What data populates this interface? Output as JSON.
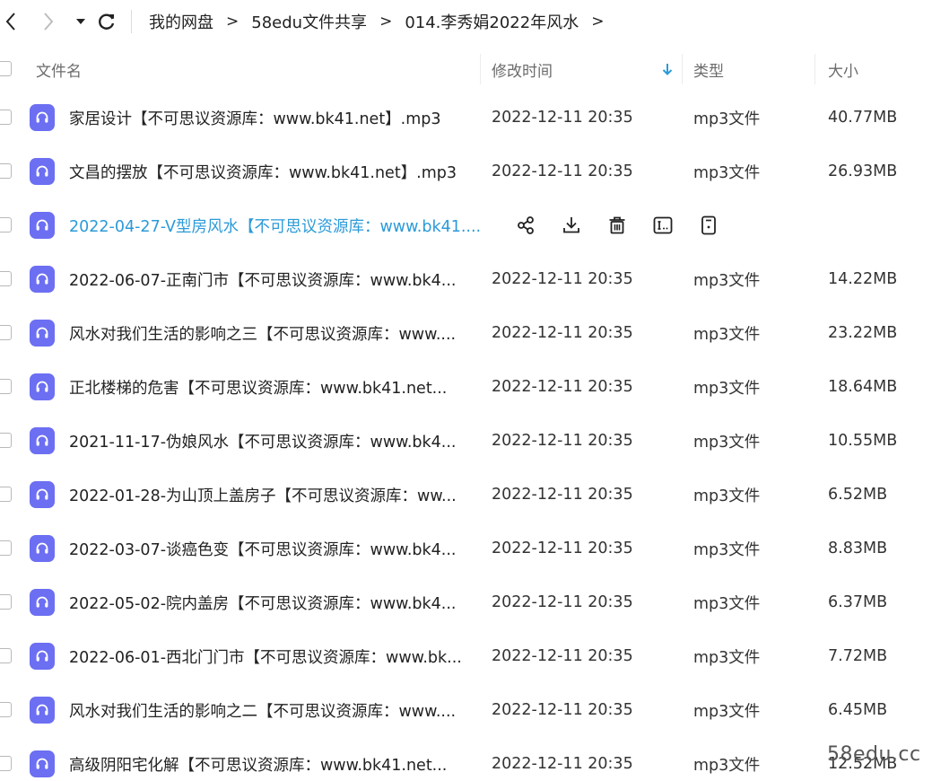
{
  "nav": {
    "back_icon": "chevron-left-icon",
    "forward_icon": "chevron-right-icon",
    "dropdown_icon": "caret-down-icon",
    "refresh_icon": "refresh-icon",
    "breadcrumbs": [
      "我的网盘",
      "58edu文件共享",
      "014.李秀娟2022年风水"
    ],
    "separator": ">"
  },
  "columns": {
    "name": "文件名",
    "modified": "修改时间",
    "type": "类型",
    "size": "大小",
    "sort_icon": "sort-down-arrow-icon"
  },
  "colors": {
    "accent": "#2b9ad8",
    "file_icon_bg": "#6c6ff2"
  },
  "files": [
    {
      "name": "家居设计【不可思议资源库：www.bk41.net】.mp3",
      "modified": "2022-12-11 20:35",
      "type": "mp3文件",
      "size": "40.77MB"
    },
    {
      "name": "文昌的摆放【不可思议资源库：www.bk41.net】.mp3",
      "modified": "2022-12-11 20:35",
      "type": "mp3文件",
      "size": "26.93MB"
    },
    {
      "name": "2022-04-27-V型房风水【不可思议资源库：www.bk41....",
      "modified": "",
      "type": "",
      "size": "",
      "hovered": true
    },
    {
      "name": "2022-06-07-正南门市【不可思议资源库：www.bk4...",
      "modified": "2022-12-11 20:35",
      "type": "mp3文件",
      "size": "14.22MB"
    },
    {
      "name": "风水对我们生活的影响之三【不可思议资源库：www....",
      "modified": "2022-12-11 20:35",
      "type": "mp3文件",
      "size": "23.22MB"
    },
    {
      "name": "正北楼梯的危害【不可思议资源库：www.bk41.net...",
      "modified": "2022-12-11 20:35",
      "type": "mp3文件",
      "size": "18.64MB"
    },
    {
      "name": "2021-11-17-伪娘风水【不可思议资源库：www.bk4...",
      "modified": "2022-12-11 20:35",
      "type": "mp3文件",
      "size": "10.55MB"
    },
    {
      "name": "2022-01-28-为山顶上盖房子【不可思议资源库：ww...",
      "modified": "2022-12-11 20:35",
      "type": "mp3文件",
      "size": "6.52MB"
    },
    {
      "name": "2022-03-07-谈癌色变【不可思议资源库：www.bk4...",
      "modified": "2022-12-11 20:35",
      "type": "mp3文件",
      "size": "8.83MB"
    },
    {
      "name": "2022-05-02-院内盖房【不可思议资源库：www.bk4...",
      "modified": "2022-12-11 20:35",
      "type": "mp3文件",
      "size": "6.37MB"
    },
    {
      "name": "2022-06-01-西北门门市【不可思议资源库：www.bk...",
      "modified": "2022-12-11 20:35",
      "type": "mp3文件",
      "size": "7.72MB"
    },
    {
      "name": "风水对我们生活的影响之二【不可思议资源库：www....",
      "modified": "2022-12-11 20:35",
      "type": "mp3文件",
      "size": "6.45MB"
    },
    {
      "name": "高级阴阳宅化解【不可思议资源库：www.bk41.net...",
      "modified": "2022-12-11 20:35",
      "type": "mp3文件",
      "size": "12.52MB"
    }
  ],
  "row_actions": [
    "share-icon",
    "download-icon",
    "delete-icon",
    "rename-icon",
    "more-icon"
  ],
  "watermark": "58edu.cc"
}
